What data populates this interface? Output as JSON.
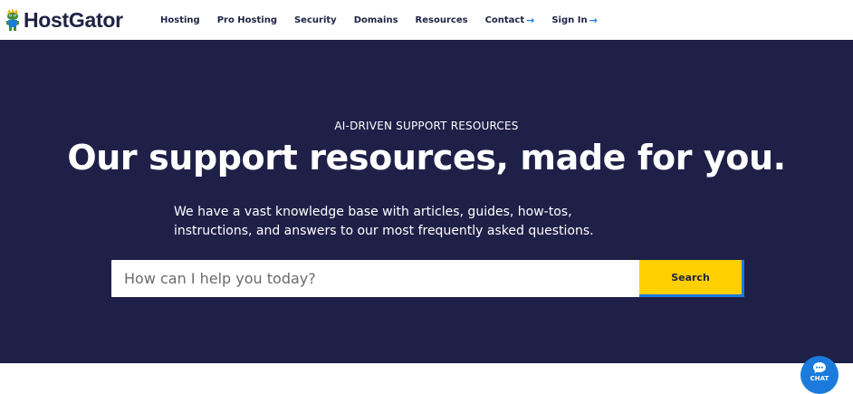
{
  "header": {
    "brand": "HostGator",
    "nav": [
      {
        "label": "Hosting",
        "arrow": ""
      },
      {
        "label": "Pro Hosting",
        "arrow": ""
      },
      {
        "label": "Security",
        "arrow": ""
      },
      {
        "label": "Domains",
        "arrow": ""
      },
      {
        "label": "Resources",
        "arrow": ""
      },
      {
        "label": "Contact",
        "arrow": "→"
      },
      {
        "label": "Sign In",
        "arrow": "→"
      }
    ]
  },
  "hero": {
    "eyebrow": "AI-DRIVEN SUPPORT RESOURCES",
    "title": "Our support resources, made for you.",
    "description_line1": "We have a vast knowledge base with articles, guides, how-tos,",
    "description_line2": "instructions, and answers to our most frequently asked questions.",
    "search_placeholder": "How can I help you today?",
    "search_button": "Search"
  },
  "chat": {
    "label": "CHAT",
    "icon": "chat-bubble-icon"
  },
  "colors": {
    "hero_bg": "#1f2048",
    "brand_navy": "#1f2243",
    "accent_yellow": "#ffcf00",
    "accent_blue": "#1a7bdc"
  }
}
